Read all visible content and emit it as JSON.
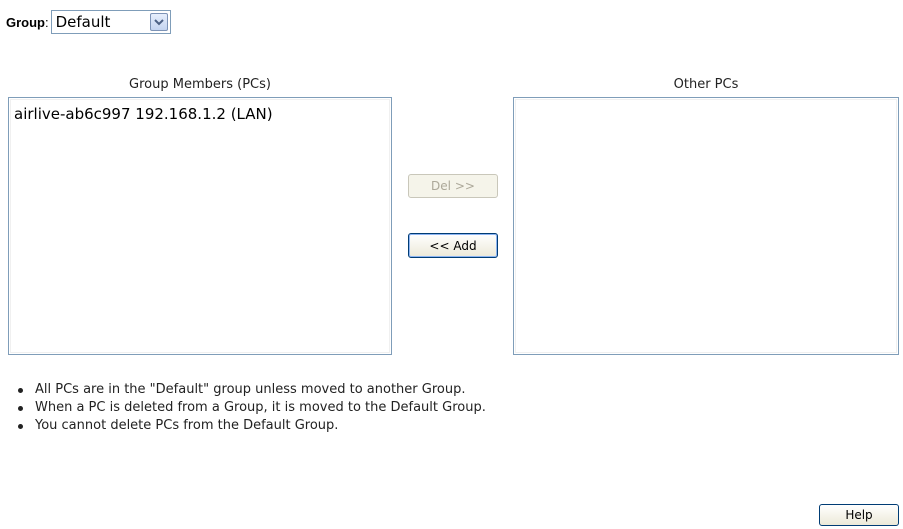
{
  "group": {
    "label": "Group",
    "colon": ":",
    "selected": "Default"
  },
  "members": {
    "header": "Group Members (PCs)",
    "items": [
      "airlive-ab6c997 192.168.1.2 (LAN)"
    ]
  },
  "others": {
    "header": "Other PCs",
    "items": []
  },
  "buttons": {
    "del_label": "Del >>",
    "add_label": "<< Add",
    "help_label": "Help"
  },
  "notes": [
    "All PCs are in the \"Default\" group unless moved to another Group.",
    "When a PC is deleted from a Group, it is moved to the Default Group.",
    "You cannot delete PCs from the Default Group."
  ],
  "icons": {
    "dropdown_arrow": "chevron-down-icon"
  }
}
